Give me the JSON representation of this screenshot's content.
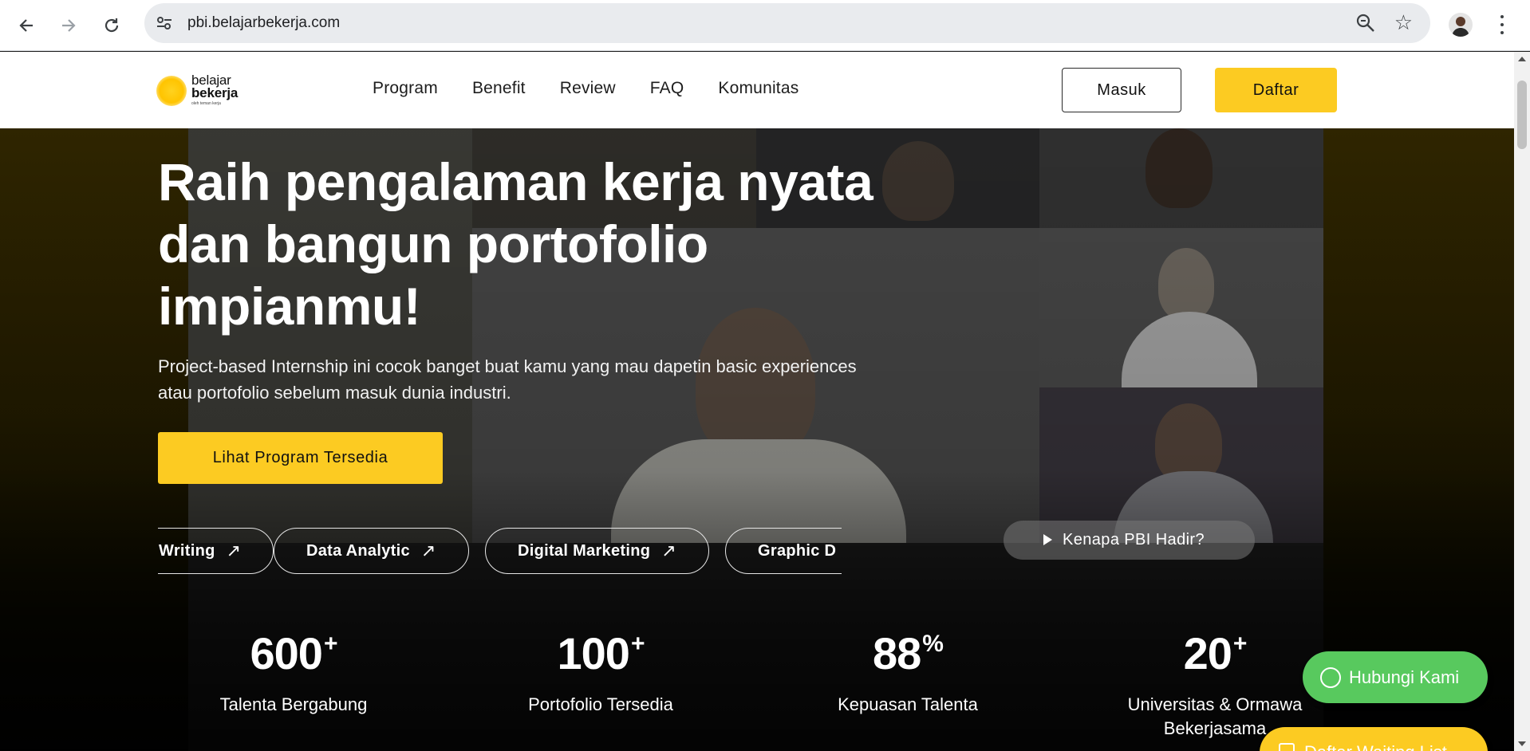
{
  "browser": {
    "url": "pbi.belajarbekerja.com",
    "icons": [
      "back-arrow-icon",
      "forward-arrow-icon",
      "reload-icon",
      "site-info-icon",
      "zoom-icon",
      "bookmark-star-icon",
      "profile-avatar",
      "menu-kebab-icon"
    ]
  },
  "nav": {
    "logo_line1": "belajar",
    "logo_line2": "bekerja",
    "logo_line3": "oleh teman kerja",
    "menu": [
      "Program",
      "Benefit",
      "Review",
      "FAQ",
      "Komunitas"
    ],
    "login_label": "Masuk",
    "register_label": "Daftar"
  },
  "hero": {
    "title": "Raih pengalaman kerja nyata dan bangun portofolio impianmu!",
    "subtitle": "Project-based Internship ini cocok banget buat kamu yang mau dapetin basic experiences atau portofolio sebelum masuk dunia industri.",
    "cta_label": "Lihat Program Tersedia",
    "program_chips": [
      "Writing",
      "Data Analytic",
      "Digital Marketing",
      "Graphic D"
    ],
    "chip_arrow": "↗",
    "video_label": "Kenapa PBI Hadir?"
  },
  "stats": [
    {
      "value": "600",
      "suffix": "+",
      "label": "Talenta Bergabung"
    },
    {
      "value": "100",
      "suffix": "+",
      "label": "Portofolio Tersedia"
    },
    {
      "value": "88",
      "suffix": "%",
      "label": "Kepuasan Talenta"
    },
    {
      "value": "20",
      "suffix": "+",
      "label": "Universitas & Ormawa Bekerjasama"
    }
  ],
  "floating": {
    "whatsapp_label": "Hubungi Kami",
    "waiting_list_label": "Daftar Waiting List"
  },
  "colors": {
    "brand_yellow": "#fccb22",
    "whatsapp_green": "#58c95e"
  }
}
